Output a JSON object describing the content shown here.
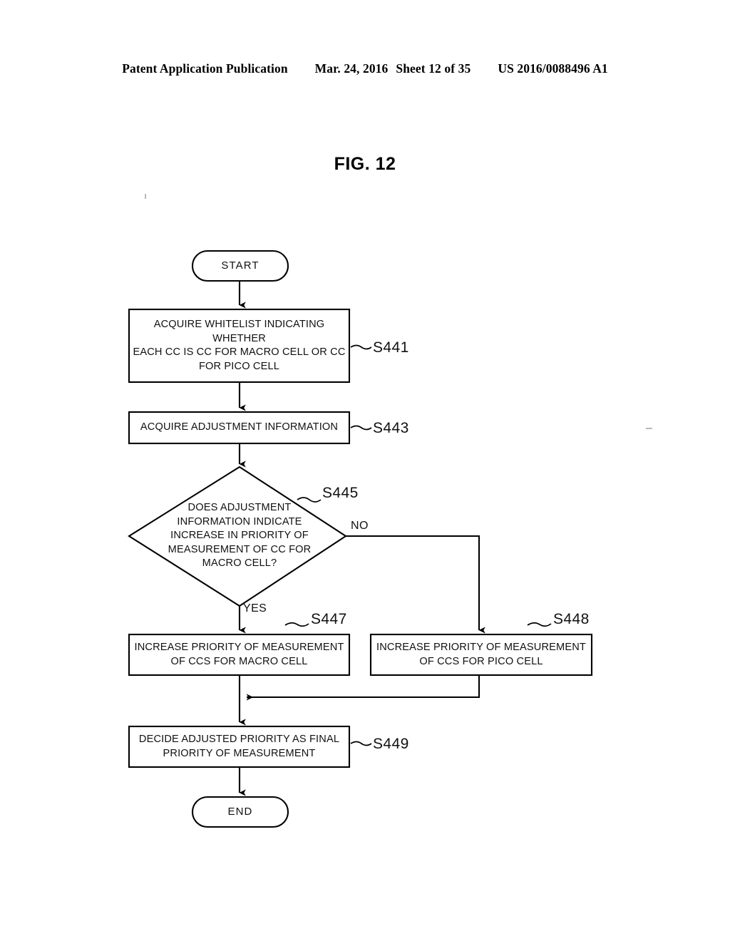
{
  "header": {
    "publication": "Patent Application Publication",
    "date": "Mar. 24, 2016",
    "sheet": "Sheet 12 of 35",
    "patent_number": "US 2016/0088496 A1"
  },
  "figure": {
    "title": "FIG. 12",
    "type": "flowchart",
    "line_color": "#000000",
    "background_color": "#ffffff"
  },
  "flowchart": {
    "start_node": {
      "label": "START",
      "shape": "terminator"
    },
    "end_node": {
      "label": "END",
      "shape": "terminator"
    },
    "steps": [
      {
        "ref": "S441",
        "shape": "process",
        "text": "ACQUIRE WHITELIST INDICATING WHETHER\nEACH CC IS CC FOR MACRO CELL OR CC\nFOR PICO CELL"
      },
      {
        "ref": "S443",
        "shape": "process",
        "text": "ACQUIRE ADJUSTMENT INFORMATION"
      },
      {
        "ref": "S445",
        "shape": "decision",
        "text": "DOES ADJUSTMENT\nINFORMATION INDICATE\nINCREASE IN PRIORITY OF\nMEASUREMENT OF CC FOR\nMACRO CELL?"
      },
      {
        "ref": "S447",
        "shape": "process",
        "text": "INCREASE PRIORITY OF MEASUREMENT\nOF CCS FOR MACRO CELL"
      },
      {
        "ref": "S448",
        "shape": "process",
        "text": "INCREASE PRIORITY OF MEASUREMENT\nOF CCS FOR PICO CELL"
      },
      {
        "ref": "S449",
        "shape": "process",
        "text": "DECIDE ADJUSTED PRIORITY AS FINAL\nPRIORITY OF MEASUREMENT"
      }
    ],
    "branches": {
      "yes_label": "YES",
      "no_label": "NO"
    }
  }
}
